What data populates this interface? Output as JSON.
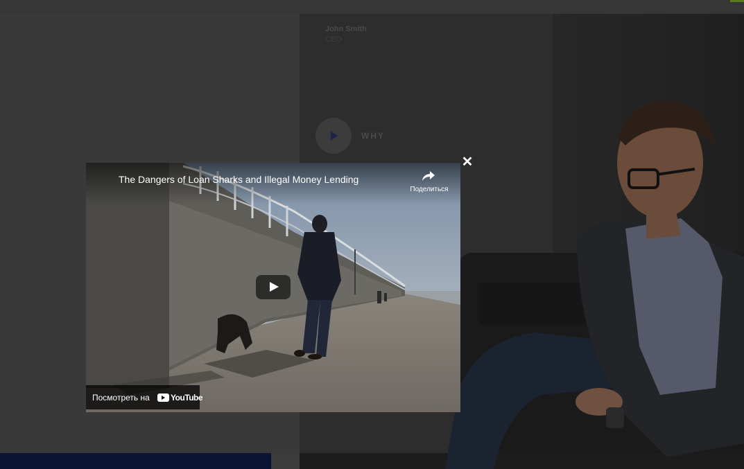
{
  "background": {
    "person_name": "John Smith",
    "person_role": "CEO",
    "why_label": "WHY"
  },
  "modal": {
    "close_label": "✕"
  },
  "video": {
    "title": "The Dangers of Loan Sharks and Illegal Money Lending",
    "share_label": "Поделиться",
    "watch_on_label": "Посмотреть на",
    "youtube_wordmark": "YouTube"
  },
  "colors": {
    "overlay_bg": "#3a3a3a",
    "navy_block": "#0b1433",
    "accent_green": "#5b7a1e"
  },
  "icons": {
    "share": "share-arrow-icon",
    "play": "play-icon",
    "close": "close-icon",
    "youtube": "youtube-logo-icon"
  }
}
